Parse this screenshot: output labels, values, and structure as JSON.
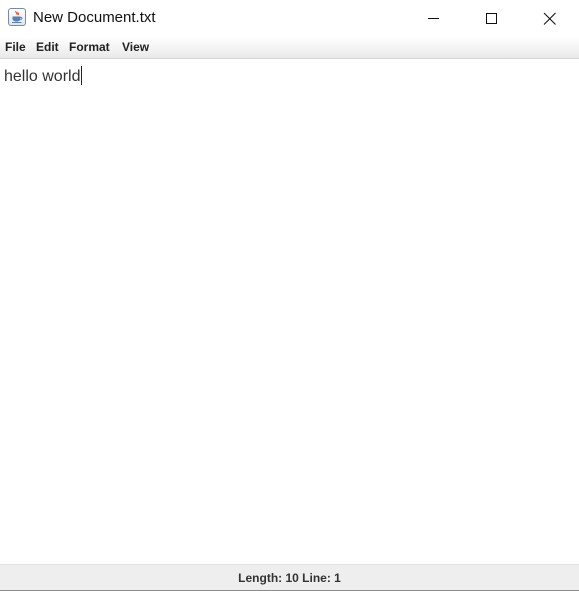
{
  "window": {
    "title": "New Document.txt",
    "app_icon": "java-cup-icon"
  },
  "title_buttons": {
    "minimize": "minimize-icon",
    "maximize": "maximize-icon",
    "close": "close-icon"
  },
  "menu": {
    "items": [
      {
        "label": "File"
      },
      {
        "label": "Edit"
      },
      {
        "label": "Format"
      },
      {
        "label": "View"
      }
    ]
  },
  "editor": {
    "content": "hello world"
  },
  "status": {
    "text": "Length: 10 Line: 1"
  }
}
